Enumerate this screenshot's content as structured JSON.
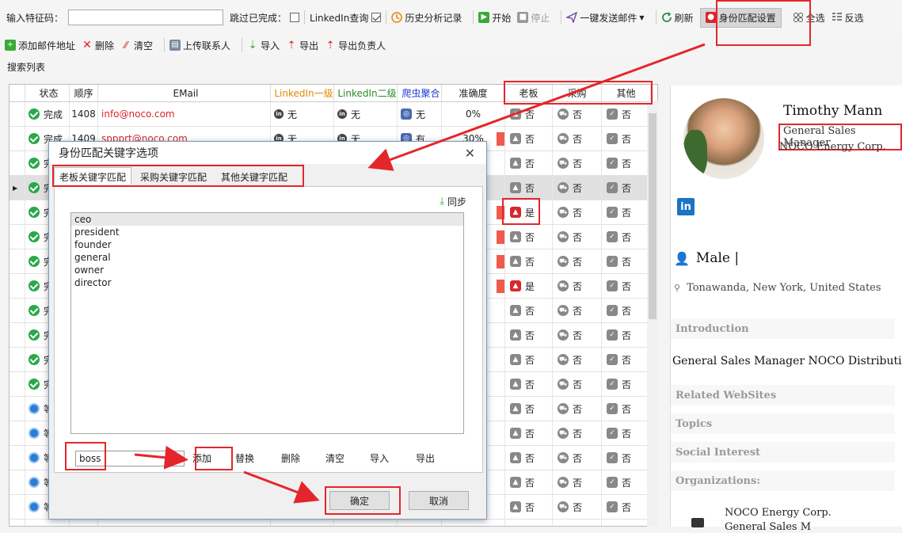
{
  "toolbar1": {
    "feature_label": "输入特征码：",
    "skip_done_label": "跳过已完成：",
    "linkedin_query_label": "LinkedIn查询",
    "history_label": "历史分析记录",
    "start_label": "开始",
    "stop_label": "停止",
    "send_mail_label": "一键发送邮件",
    "refresh_label": "刷新",
    "identity_label": "身份匹配设置",
    "select_all_label": "全选",
    "invert_label": "反选"
  },
  "toolbar2": {
    "add_email_label": "添加邮件地址",
    "delete_label": "删除",
    "clear_label": "清空",
    "upload_label": "上传联系人",
    "import_label": "导入",
    "export_label": "导出",
    "export_owner_label": "导出负责人"
  },
  "list_label": "搜索列表",
  "grid": {
    "headers": [
      "状态",
      "顺序",
      "EMail",
      "LinkedIn一级",
      "LinkedIn二级",
      "爬虫聚合",
      "准确度",
      "老板",
      "采购",
      "其他"
    ],
    "header_colors": {
      "li1": "#e08a00",
      "li2": "#2a8a2a",
      "crawler": "#1e3cd6"
    },
    "rows": [
      {
        "status": "完成",
        "seq": "1408",
        "email": "info@noco.com",
        "li1": "无",
        "li2": "无",
        "crawl": "无",
        "acc": "0%",
        "boss": "否",
        "buy": "否",
        "other": "否",
        "done": true,
        "boss_red": false
      },
      {
        "status": "完成",
        "seq": "1409",
        "email": "sppprt@noco.com",
        "li1": "无",
        "li2": "无",
        "crawl": "有",
        "acc": "30%",
        "boss": "否",
        "buy": "否",
        "other": "否",
        "done": true,
        "boss_red": false
      },
      {
        "status": "完",
        "seq": "",
        "email": "",
        "li1": "",
        "li2": "",
        "crawl": "",
        "acc": "",
        "boss": "否",
        "buy": "否",
        "other": "否",
        "done": true,
        "boss_red": false
      },
      {
        "status": "完",
        "seq": "",
        "email": "",
        "li1": "",
        "li2": "",
        "crawl": "",
        "acc": "",
        "boss": "否",
        "buy": "否",
        "other": "否",
        "done": true,
        "boss_red": false
      },
      {
        "status": "完",
        "seq": "",
        "email": "",
        "li1": "",
        "li2": "",
        "crawl": "",
        "acc": "",
        "boss": "是",
        "buy": "否",
        "other": "否",
        "done": true,
        "boss_red": true
      },
      {
        "status": "完",
        "seq": "",
        "email": "",
        "li1": "",
        "li2": "",
        "crawl": "",
        "acc": "",
        "boss": "否",
        "buy": "否",
        "other": "否",
        "done": true,
        "boss_red": false
      },
      {
        "status": "完",
        "seq": "",
        "email": "",
        "li1": "",
        "li2": "",
        "crawl": "",
        "acc": "",
        "boss": "否",
        "buy": "否",
        "other": "否",
        "done": true,
        "boss_red": false
      },
      {
        "status": "完",
        "seq": "",
        "email": "",
        "li1": "",
        "li2": "",
        "crawl": "",
        "acc": "",
        "boss": "是",
        "buy": "否",
        "other": "否",
        "done": true,
        "boss_red": true
      },
      {
        "status": "完",
        "seq": "",
        "email": "",
        "li1": "",
        "li2": "",
        "crawl": "",
        "acc": "",
        "boss": "否",
        "buy": "否",
        "other": "否",
        "done": true,
        "boss_red": false
      },
      {
        "status": "完",
        "seq": "",
        "email": "",
        "li1": "",
        "li2": "",
        "crawl": "",
        "acc": "",
        "boss": "否",
        "buy": "否",
        "other": "否",
        "done": true,
        "boss_red": false
      },
      {
        "status": "完",
        "seq": "",
        "email": "",
        "li1": "",
        "li2": "",
        "crawl": "",
        "acc": "",
        "boss": "否",
        "buy": "否",
        "other": "否",
        "done": true,
        "boss_red": false
      },
      {
        "status": "完",
        "seq": "",
        "email": "",
        "li1": "",
        "li2": "",
        "crawl": "",
        "acc": "",
        "boss": "否",
        "buy": "否",
        "other": "否",
        "done": true,
        "boss_red": false
      },
      {
        "status": "等",
        "seq": "",
        "email": "",
        "li1": "",
        "li2": "",
        "crawl": "",
        "acc": "",
        "boss": "否",
        "buy": "否",
        "other": "否",
        "done": false,
        "boss_red": false
      },
      {
        "status": "等",
        "seq": "",
        "email": "",
        "li1": "",
        "li2": "",
        "crawl": "",
        "acc": "",
        "boss": "否",
        "buy": "否",
        "other": "否",
        "done": false,
        "boss_red": false
      },
      {
        "status": "等",
        "seq": "",
        "email": "",
        "li1": "",
        "li2": "",
        "crawl": "",
        "acc": "",
        "boss": "否",
        "buy": "否",
        "other": "否",
        "done": false,
        "boss_red": false
      },
      {
        "status": "等",
        "seq": "",
        "email": "",
        "li1": "",
        "li2": "",
        "crawl": "",
        "acc": "",
        "boss": "否",
        "buy": "否",
        "other": "否",
        "done": false,
        "boss_red": false
      },
      {
        "status": "等",
        "seq": "",
        "email": "",
        "li1": "",
        "li2": "",
        "crawl": "",
        "acc": "",
        "boss": "否",
        "buy": "否",
        "other": "否",
        "done": false,
        "boss_red": false
      },
      {
        "status": "等",
        "seq": "",
        "email": "",
        "li1": "",
        "li2": "",
        "crawl": "",
        "acc": "",
        "boss": "否",
        "buy": "否",
        "other": "否",
        "done": false,
        "boss_red": false
      }
    ]
  },
  "profile": {
    "name": "Timothy Mann",
    "title": "General Sales Manager",
    "company": "NOCO Energy Corp.",
    "linkedin_glyph": "in",
    "gender": "Male |",
    "location": "Tonawanda, New York, United States",
    "sections": {
      "introduction": "Introduction",
      "related": "Related WebSites",
      "topics": "Topics",
      "social": "Social Interest",
      "orgs": "Organizations:"
    },
    "intro_text": "General Sales Manager NOCO Distribution",
    "org_name": "NOCO Energy Corp.",
    "org_title": "General Sales M"
  },
  "dialog": {
    "title": "身份匹配关键字选项",
    "close": "✕",
    "tabs": [
      "老板关键字匹配",
      "采购关键字匹配",
      "其他关键字匹配"
    ],
    "sync_label": "同步",
    "keywords": [
      "ceo",
      "president",
      "founder",
      "general",
      "owner",
      "director"
    ],
    "input_value": "boss",
    "actions": {
      "add": "添加",
      "replace": "替换",
      "delete": "删除",
      "clear": "清空",
      "import": "导入",
      "export": "导出"
    },
    "ok_label": "确定",
    "cancel_label": "取消"
  }
}
